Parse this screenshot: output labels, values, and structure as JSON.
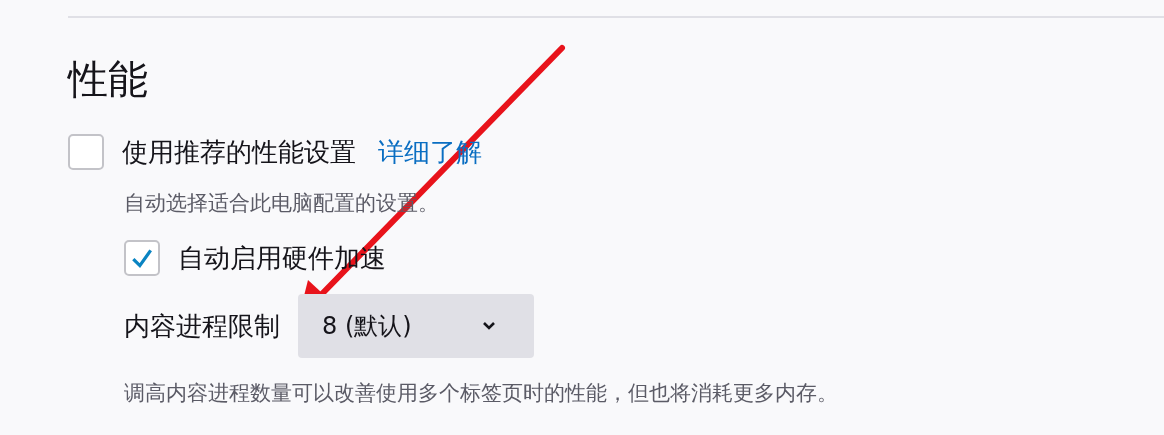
{
  "section": {
    "title": "性能"
  },
  "recommended": {
    "label": "使用推荐的性能设置",
    "link": "详细了解",
    "checked": false,
    "description": "自动选择适合此电脑配置的设置。"
  },
  "hardware_acceleration": {
    "label": "自动启用硬件加速",
    "checked": true
  },
  "content_process_limit": {
    "label": "内容进程限制",
    "value": "8 (默认)",
    "description": "调高内容进程数量可以改善使用多个标签页时的性能，但也将消耗更多内存。"
  }
}
